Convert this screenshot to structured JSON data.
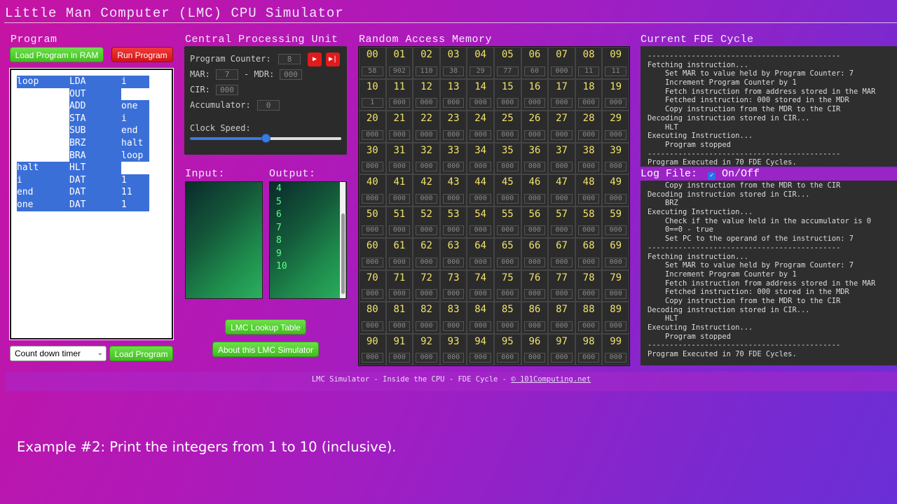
{
  "app": {
    "title": "Little Man Computer (LMC) CPU Simulator"
  },
  "program": {
    "title": "Program",
    "load_ram_label": "Load Program in RAM",
    "run_label": "Run Program",
    "code": [
      {
        "label": "loop",
        "op": "LDA",
        "arg": "i"
      },
      {
        "label": "",
        "op": "OUT",
        "arg": ""
      },
      {
        "label": "",
        "op": "ADD",
        "arg": "one"
      },
      {
        "label": "",
        "op": "STA",
        "arg": "i"
      },
      {
        "label": "",
        "op": "SUB",
        "arg": "end"
      },
      {
        "label": "",
        "op": "BRZ",
        "arg": "halt"
      },
      {
        "label": "",
        "op": "BRA",
        "arg": "loop"
      },
      {
        "label": "halt",
        "op": "HLT",
        "arg": ""
      },
      {
        "label": "i",
        "op": "DAT",
        "arg": "1"
      },
      {
        "label": "end",
        "op": "DAT",
        "arg": "11"
      },
      {
        "label": "one",
        "op": "DAT",
        "arg": "1"
      }
    ],
    "selected_program": "Count down timer",
    "load_program_label": "Load Program"
  },
  "cpu": {
    "title": "Central Processing Unit",
    "pc_label": "Program Counter:",
    "pc_value": "8",
    "mar_label": "MAR:",
    "mar_value": "7",
    "mdr_label": "- MDR:",
    "mdr_value": "000",
    "cir_label": "CIR:",
    "cir_value": "000",
    "acc_label": "Accumulator:",
    "acc_value": "0",
    "clock_label": "Clock Speed:",
    "clock_level": 0.5
  },
  "io": {
    "input_label": "Input:",
    "output_label": "Output:",
    "output_lines": [
      "4",
      "5",
      "6",
      "7",
      "8",
      "9",
      "10"
    ]
  },
  "buttons": {
    "lookup_label": "LMC Lookup Table",
    "about_label": "About this LMC Simulator"
  },
  "ram": {
    "title": "Random Access Memory",
    "values": [
      "58",
      "902",
      "110",
      "38",
      "29",
      "77",
      "60",
      "000",
      "11",
      "11",
      "1",
      "000",
      "000",
      "000",
      "000",
      "000",
      "000",
      "000",
      "000",
      "000",
      "000",
      "000",
      "000",
      "000",
      "000",
      "000",
      "000",
      "000",
      "000",
      "000",
      "000",
      "000",
      "000",
      "000",
      "000",
      "000",
      "000",
      "000",
      "000",
      "000",
      "000",
      "000",
      "000",
      "000",
      "000",
      "000",
      "000",
      "000",
      "000",
      "000",
      "000",
      "000",
      "000",
      "000",
      "000",
      "000",
      "000",
      "000",
      "000",
      "000",
      "000",
      "000",
      "000",
      "000",
      "000",
      "000",
      "000",
      "000",
      "000",
      "000",
      "000",
      "000",
      "000",
      "000",
      "000",
      "000",
      "000",
      "000",
      "000",
      "000",
      "000",
      "000",
      "000",
      "000",
      "000",
      "000",
      "000",
      "000",
      "000",
      "000",
      "000",
      "000",
      "000",
      "000",
      "000",
      "000",
      "000",
      "000",
      "000",
      "000"
    ]
  },
  "fde": {
    "title": "Current FDE Cycle",
    "lines": [
      "--------------------------------------------",
      "Fetching instruction...",
      "    Set MAR to value held by Program Counter: 7",
      "    Increment Program Counter by 1",
      "    Fetch instruction from address stored in the MAR",
      "    Fetched instruction: 000 stored in the MDR",
      "    Copy instruction from the MDR to the CIR",
      "Decoding instruction stored in CIR...",
      "    HLT",
      "Executing Instruction...",
      "    Program stopped",
      "--------------------------------------------",
      "Program Executed in 70 FDE Cycles."
    ]
  },
  "log": {
    "title": "Log File:",
    "toggle_label": "On/Off",
    "lines": [
      "    Copy instruction from the MDR to the CIR",
      "Decoding instruction stored in CIR...",
      "    BRZ",
      "Executing Instruction...",
      "    Check if the value held in the accumulator is 0",
      "    0==0 - true",
      "    Set PC to the operand of the instruction: 7",
      "--------------------------------------------",
      "Fetching instruction...",
      "    Set MAR to value held by Program Counter: 7",
      "    Increment Program Counter by 1",
      "    Fetch instruction from address stored in the MAR",
      "    Fetched instruction: 000 stored in the MDR",
      "    Copy instruction from the MDR to the CIR",
      "Decoding instruction stored in CIR...",
      "    HLT",
      "Executing Instruction...",
      "    Program stopped",
      "--------------------------------------------",
      "Program Executed in 70 FDE Cycles."
    ]
  },
  "footer": {
    "text": "LMC Simulator - Inside the CPU - FDE Cycle - ",
    "link": "© 101Computing.net"
  },
  "caption": "Example #2: Print the integers from 1 to 10 (inclusive)."
}
